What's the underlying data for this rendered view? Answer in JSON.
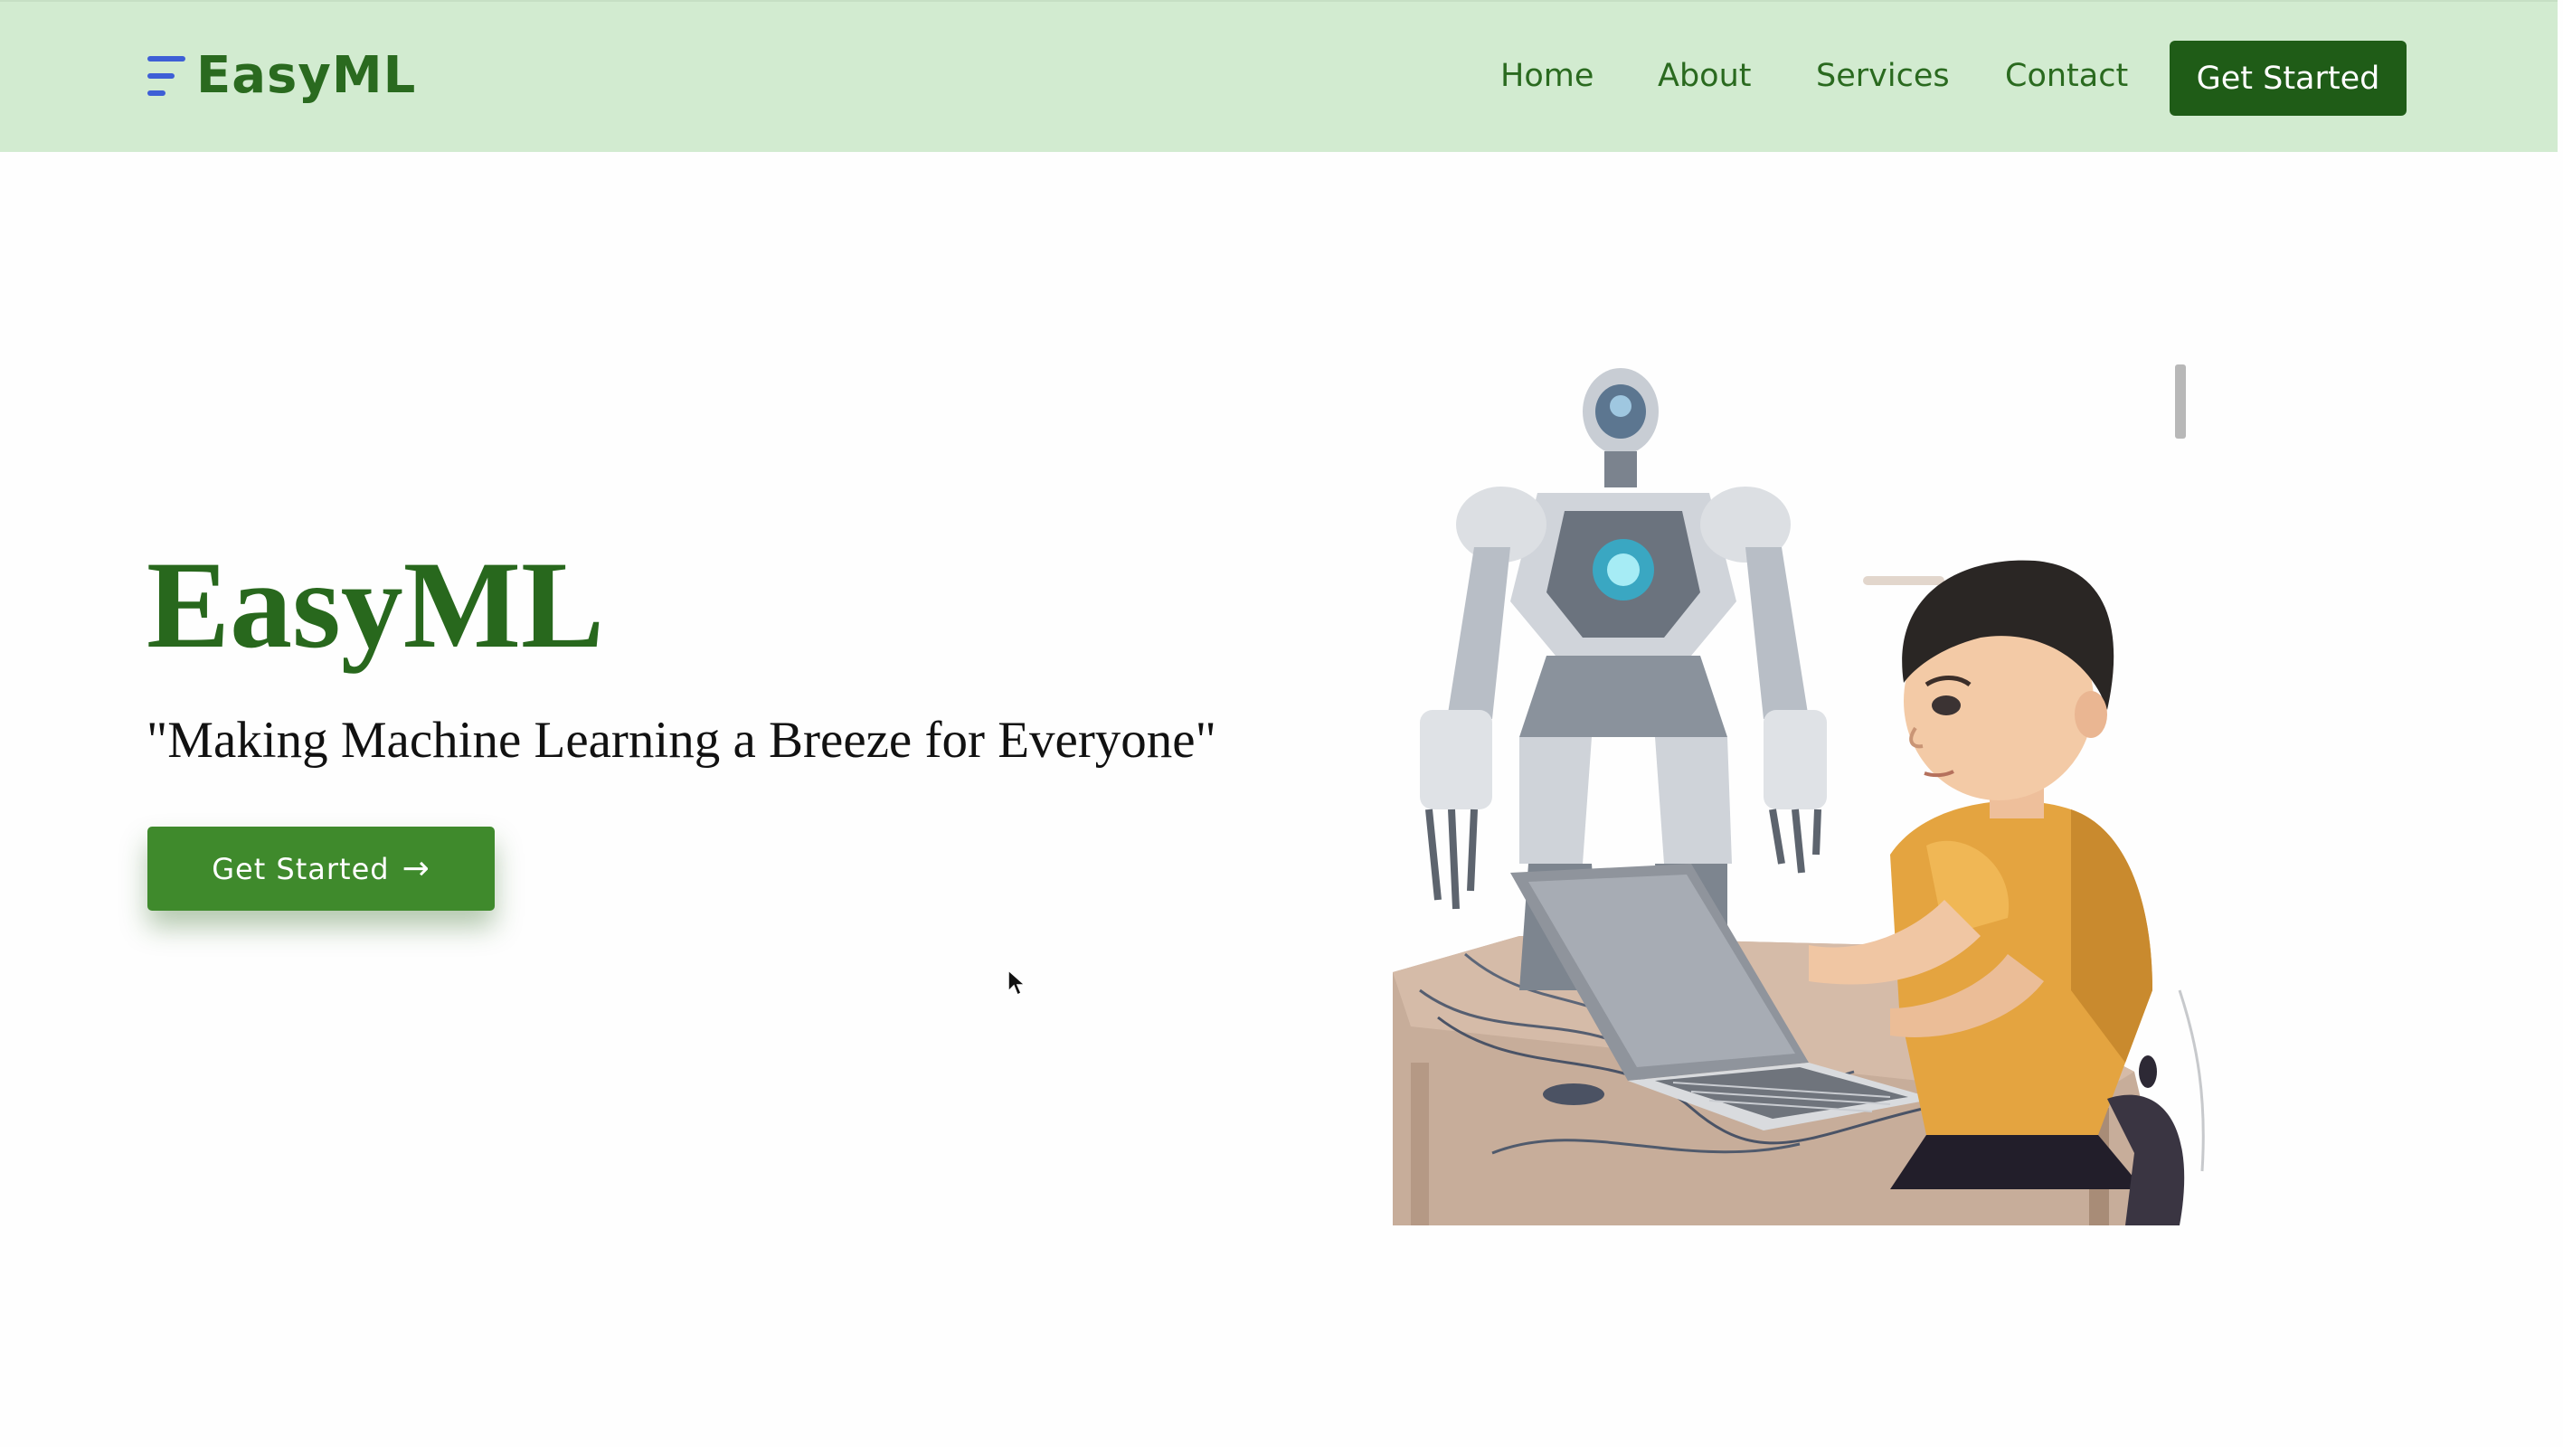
{
  "nav": {
    "brand": "EasyML",
    "links": [
      "Home",
      "About",
      "Services",
      "Contact"
    ],
    "cta_label": "Get Started"
  },
  "hero": {
    "title": "EasyML",
    "tagline": "\"Making Machine Learning a Breeze for Everyone\"",
    "cta_label": "Get Started",
    "cta_icon": "arrow-right-icon",
    "image_alt": "boy-at-laptop-with-robot-illustration"
  },
  "colors": {
    "navbar_bg": "#d2ebd0",
    "brand_green": "#2a6a1f",
    "nav_cta_bg": "#1f5c17",
    "hero_cta_bg": "#3f8a2c",
    "brand_icon": "#3e5fd6"
  }
}
